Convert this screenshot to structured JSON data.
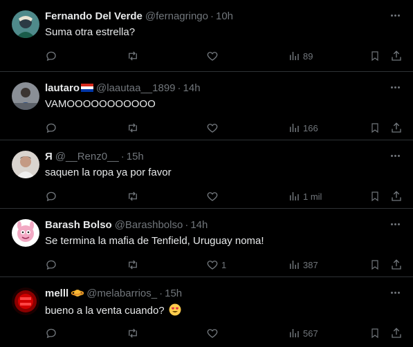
{
  "colors": {
    "background": "#000000",
    "text": "#e7e9ea",
    "muted": "#71767b",
    "divider": "#2f3336"
  },
  "icons": {
    "reply": "reply-icon",
    "retweet": "retweet-icon",
    "like": "heart-icon",
    "views": "views-icon",
    "bookmark": "bookmark-icon",
    "share": "share-icon",
    "more": "more-icon"
  },
  "tweets": [
    {
      "name": "Fernando Del Verde",
      "handle": "@fernagringo",
      "time": "10h",
      "text": "Suma otra estrella?",
      "likes": "",
      "views": "89"
    },
    {
      "name": "lautaro",
      "handle": "@laautaa__1899",
      "time": "14h",
      "text": "VAMOOOOOOOOOOO",
      "likes": "",
      "views": "166"
    },
    {
      "name": "Я",
      "handle": "@__Renz0__",
      "time": "15h",
      "text": "saquen la ropa ya por favor",
      "likes": "",
      "views": "1 mil"
    },
    {
      "name": "Barash Bolso",
      "handle": "@Barashbolso",
      "time": "14h",
      "text": "Se termina la mafia de Tenfield, Uruguay noma!",
      "likes": "1",
      "views": "387"
    },
    {
      "name": "melll",
      "handle": "@melabarrios_",
      "time": "15h",
      "text": "bueno a la venta cuando?",
      "likes": "",
      "views": "567"
    }
  ]
}
